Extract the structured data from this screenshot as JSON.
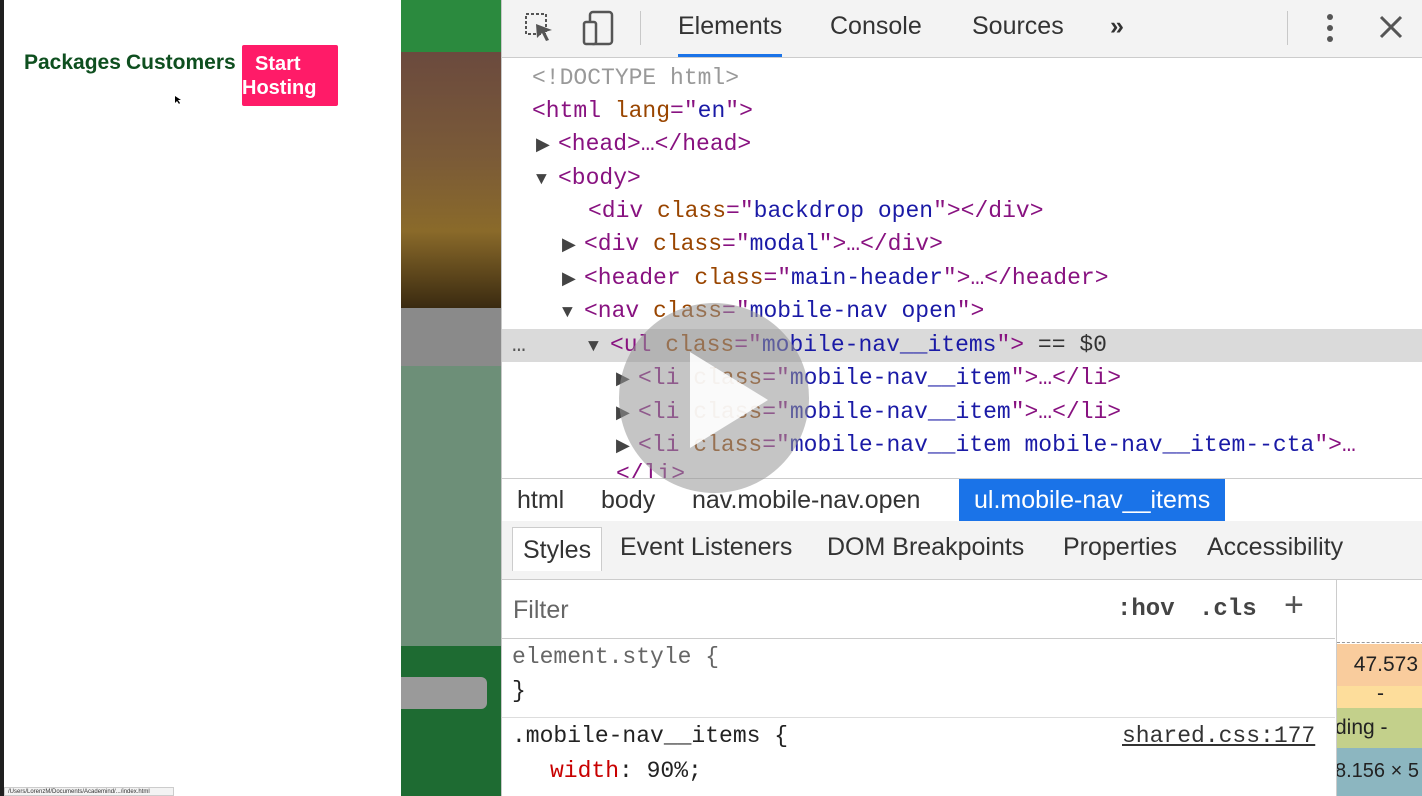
{
  "page": {
    "nav_packages": "Packages",
    "nav_customers": "Customers",
    "cta_line1": "Start",
    "cta_line2": "Hosting",
    "status_url": "/Users/LorenzM/Documents/Academind/.../index.html"
  },
  "devtools": {
    "tabs": [
      "Elements",
      "Console",
      "Sources"
    ],
    "more_tabs_icon": "»",
    "dom": {
      "doctype": "<!DOCTYPE html>",
      "html_open": "<html",
      "html_lang_attr": "lang",
      "html_lang_val": "en",
      "head": "<head>…</head>",
      "body_open": "<body>",
      "div_backdrop_class": "backdrop open",
      "div_modal_class": "modal",
      "header_class": "main-header",
      "nav_class": "mobile-nav open",
      "ul_class": "mobile-nav__items",
      "ul_suffix": "== $0",
      "li1_class": "mobile-nav__item",
      "li2_class": "mobile-nav__item",
      "li3_class": "mobile-nav__item mobile-nav__item--cta",
      "li_close": "</li>"
    },
    "breadcrumb": [
      "html",
      "body",
      "nav.mobile-nav.open",
      "ul.mobile-nav__items"
    ],
    "style_tabs": [
      "Styles",
      "Event Listeners",
      "DOM Breakpoints",
      "Properties",
      "Accessibility"
    ],
    "filter_placeholder": "Filter",
    "hov": ":hov",
    "cls": ".cls",
    "add_rule": "+",
    "element_style": "element.style {",
    "close_brace": "}",
    "rule_selector": ".mobile-nav__items {",
    "rule_source": "shared.css:177",
    "rule_prop": "width",
    "rule_value": "90%;",
    "boxmodel": {
      "value1": "47.573",
      "value2": "-",
      "label": "ding -",
      "size": "8.156 × 5"
    }
  }
}
